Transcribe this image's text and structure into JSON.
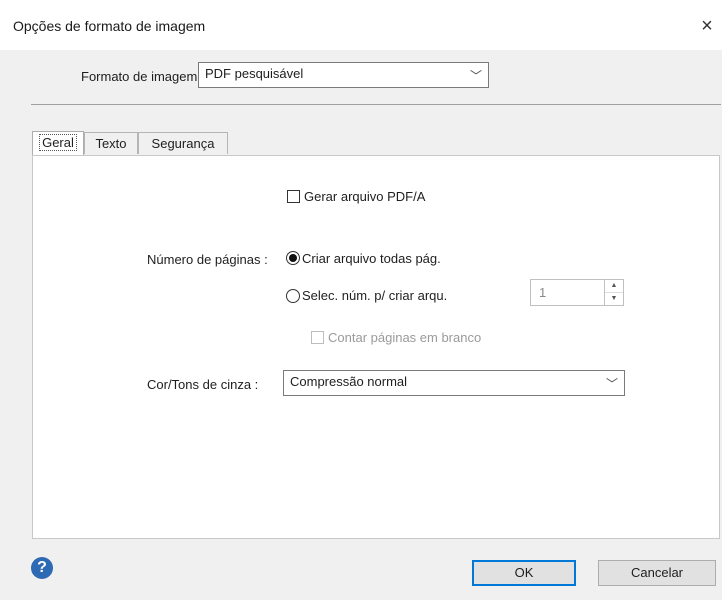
{
  "window": {
    "title": "Opções de formato de imagem",
    "close_icon": "×"
  },
  "format": {
    "label": "Formato de imagem :",
    "value": "PDF pesquisável"
  },
  "tabs": [
    {
      "label": "Geral",
      "active": true
    },
    {
      "label": "Texto",
      "active": false
    },
    {
      "label": "Segurança",
      "active": false
    }
  ],
  "general": {
    "pdfa_label": "Gerar arquivo PDF/A",
    "pdfa_checked": false,
    "pages_label": "Número de páginas :",
    "pages_option_all": "Criar arquivo todas pág.",
    "pages_option_select": "Selec. núm. p/ criar arqu.",
    "pages_selected": "all",
    "pages_count": "1",
    "count_blank_label": "Contar páginas em branco",
    "color_label": "Cor/Tons de cinza :",
    "color_value": "Compressão normal"
  },
  "footer": {
    "help_icon": "?",
    "ok_label": "OK",
    "cancel_label": "Cancelar"
  },
  "colors": {
    "accent": "#0078d7",
    "help": "#2c6bb3",
    "background": "#f0f0f0"
  }
}
